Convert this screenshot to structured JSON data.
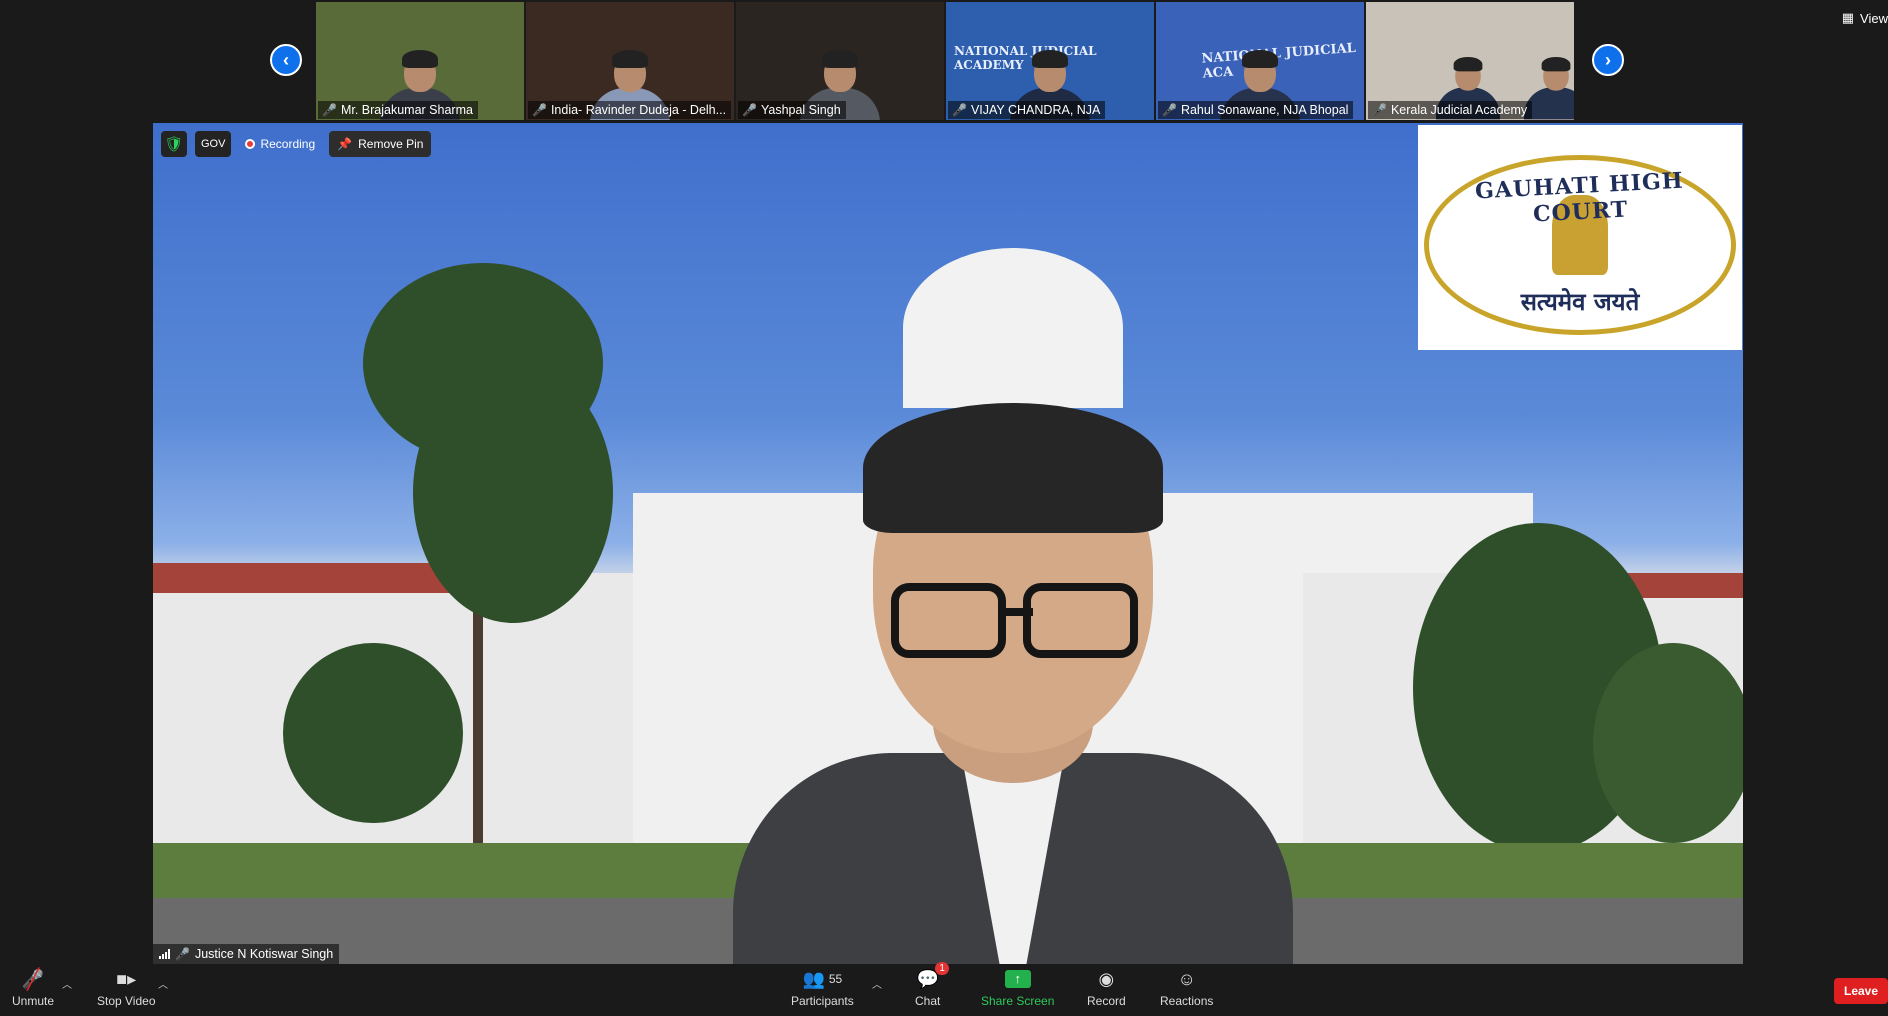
{
  "top_right": {
    "view_label": "View"
  },
  "participants_strip": [
    {
      "name": "Mr. Brajakumar Sharma",
      "bg": "#5a6b3a"
    },
    {
      "name": "India- Ravinder Dudeja - Delh...",
      "bg": "#3b2a22"
    },
    {
      "name": "Yashpal Singh",
      "bg": "#2a2520"
    },
    {
      "name": "VIJAY CHANDRA, NJA",
      "bg": "#2d5fae",
      "banner": "NATIONAL JUDICIAL ACADEMY"
    },
    {
      "name": "Rahul Sonawane, NJA Bhopal",
      "bg": "#3a62b8",
      "banner": "NATIONAL JUDICIAL ACA"
    },
    {
      "name": "Kerala Judicial Academy",
      "bg": "#c9c2b8"
    }
  ],
  "main_video": {
    "badges": {
      "gov": "GOV",
      "recording": "Recording",
      "remove_pin": "Remove Pin"
    },
    "speaker_name": "Justice N Kotiswar Singh",
    "logo": {
      "title": "GAUHATI HIGH COURT",
      "motto": "सत्यमेव जयते"
    }
  },
  "toolbar": {
    "unmute": "Unmute",
    "stop_video": "Stop Video",
    "participants": "Participants",
    "participants_count": "55",
    "chat": "Chat",
    "chat_badge": "1",
    "share_screen": "Share Screen",
    "record": "Record",
    "reactions": "Reactions",
    "leave": "Leave"
  }
}
